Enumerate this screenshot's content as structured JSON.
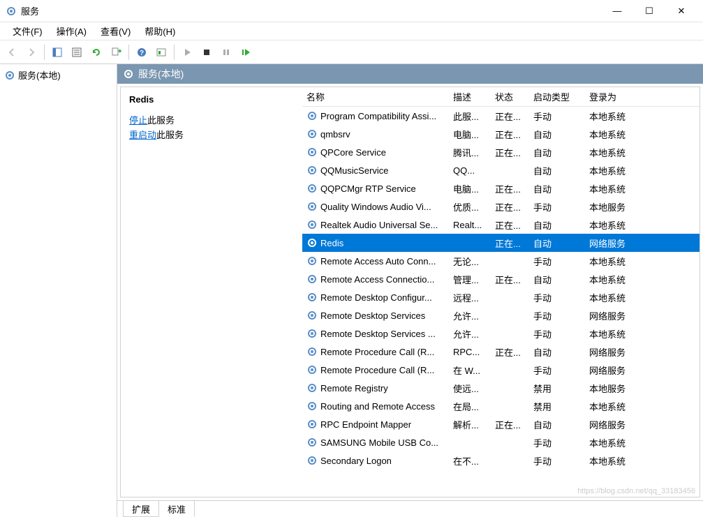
{
  "window": {
    "title": "服务"
  },
  "menu": {
    "file": "文件(F)",
    "action": "操作(A)",
    "view": "查看(V)",
    "help": "帮助(H)"
  },
  "tree": {
    "root": "服务(本地)"
  },
  "pane_header": "服务(本地)",
  "detail": {
    "selected_name": "Redis",
    "stop_link": "停止",
    "stop_tail": "此服务",
    "restart_link": "重启动",
    "restart_tail": "此服务"
  },
  "columns": {
    "name": "名称",
    "desc": "描述",
    "status": "状态",
    "start": "启动类型",
    "logon": "登录为"
  },
  "tabs": {
    "extended": "扩展",
    "standard": "标准"
  },
  "services": [
    {
      "name": "Program Compatibility Assi...",
      "desc": "此服...",
      "status": "正在...",
      "start": "手动",
      "logon": "本地系统",
      "selected": false
    },
    {
      "name": "qmbsrv",
      "desc": "电脑...",
      "status": "正在...",
      "start": "自动",
      "logon": "本地系统",
      "selected": false
    },
    {
      "name": "QPCore Service",
      "desc": "腾讯...",
      "status": "正在...",
      "start": "自动",
      "logon": "本地系统",
      "selected": false
    },
    {
      "name": "QQMusicService",
      "desc": "QQ...",
      "status": "",
      "start": "自动",
      "logon": "本地系统",
      "selected": false
    },
    {
      "name": "QQPCMgr RTP Service",
      "desc": "电脑...",
      "status": "正在...",
      "start": "自动",
      "logon": "本地系统",
      "selected": false
    },
    {
      "name": "Quality Windows Audio Vi...",
      "desc": "优质...",
      "status": "正在...",
      "start": "手动",
      "logon": "本地服务",
      "selected": false
    },
    {
      "name": "Realtek Audio Universal Se...",
      "desc": "Realt...",
      "status": "正在...",
      "start": "自动",
      "logon": "本地系统",
      "selected": false
    },
    {
      "name": "Redis",
      "desc": "",
      "status": "正在...",
      "start": "自动",
      "logon": "网络服务",
      "selected": true
    },
    {
      "name": "Remote Access Auto Conn...",
      "desc": "无论...",
      "status": "",
      "start": "手动",
      "logon": "本地系统",
      "selected": false
    },
    {
      "name": "Remote Access Connectio...",
      "desc": "管理...",
      "status": "正在...",
      "start": "自动",
      "logon": "本地系统",
      "selected": false
    },
    {
      "name": "Remote Desktop Configur...",
      "desc": "远程...",
      "status": "",
      "start": "手动",
      "logon": "本地系统",
      "selected": false
    },
    {
      "name": "Remote Desktop Services",
      "desc": "允许...",
      "status": "",
      "start": "手动",
      "logon": "网络服务",
      "selected": false
    },
    {
      "name": "Remote Desktop Services ...",
      "desc": "允许...",
      "status": "",
      "start": "手动",
      "logon": "本地系统",
      "selected": false
    },
    {
      "name": "Remote Procedure Call (R...",
      "desc": "RPC...",
      "status": "正在...",
      "start": "自动",
      "logon": "网络服务",
      "selected": false
    },
    {
      "name": "Remote Procedure Call (R...",
      "desc": "在 W...",
      "status": "",
      "start": "手动",
      "logon": "网络服务",
      "selected": false
    },
    {
      "name": "Remote Registry",
      "desc": "使远...",
      "status": "",
      "start": "禁用",
      "logon": "本地服务",
      "selected": false
    },
    {
      "name": "Routing and Remote Access",
      "desc": "在局...",
      "status": "",
      "start": "禁用",
      "logon": "本地系统",
      "selected": false
    },
    {
      "name": "RPC Endpoint Mapper",
      "desc": "解析...",
      "status": "正在...",
      "start": "自动",
      "logon": "网络服务",
      "selected": false
    },
    {
      "name": "SAMSUNG Mobile USB Co...",
      "desc": "",
      "status": "",
      "start": "手动",
      "logon": "本地系统",
      "selected": false
    },
    {
      "name": "Secondary Logon",
      "desc": "在不...",
      "status": "",
      "start": "手动",
      "logon": "本地系统",
      "selected": false
    }
  ]
}
